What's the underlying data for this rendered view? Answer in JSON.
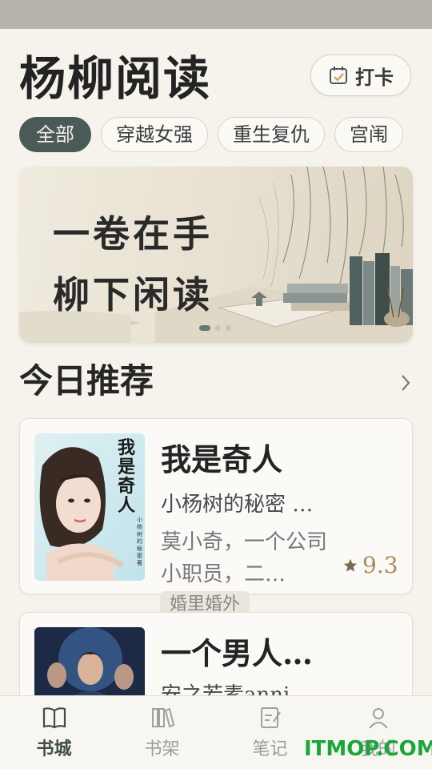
{
  "app": {
    "title": "杨柳阅读",
    "checkin_label": "打卡"
  },
  "tabs": [
    {
      "label": "全部",
      "active": true
    },
    {
      "label": "穿越女强",
      "active": false
    },
    {
      "label": "重生复仇",
      "active": false
    },
    {
      "label": "宫闱",
      "active": false
    }
  ],
  "banner": {
    "line1": "一卷在手",
    "line2": "柳下闲读",
    "slide_count": 3,
    "active_slide": 1
  },
  "recommend": {
    "title": "今日推荐",
    "books": [
      {
        "title": "我是奇人",
        "author": "小杨树的秘密 …",
        "description": "莫小奇，一个公司小职员，二…",
        "rating": "9.3",
        "tag": "婚里婚外",
        "cover_text": "我是奇人",
        "cover_subtext": "小杨树的秘密 著"
      },
      {
        "title": "一个男人…",
        "author": "安之若素anni…"
      }
    ]
  },
  "nav": {
    "items": [
      {
        "label": "书城",
        "icon": "book-open-icon",
        "active": true
      },
      {
        "label": "书架",
        "icon": "bookshelf-icon",
        "active": false
      },
      {
        "label": "笔记",
        "icon": "note-edit-icon",
        "active": false
      },
      {
        "label": "我的",
        "icon": "user-icon",
        "active": false
      }
    ]
  },
  "watermark": "ITMOP.COM",
  "colors": {
    "accent": "#4a5a57",
    "background": "#f6f3ec",
    "rating": "#a88a57"
  }
}
